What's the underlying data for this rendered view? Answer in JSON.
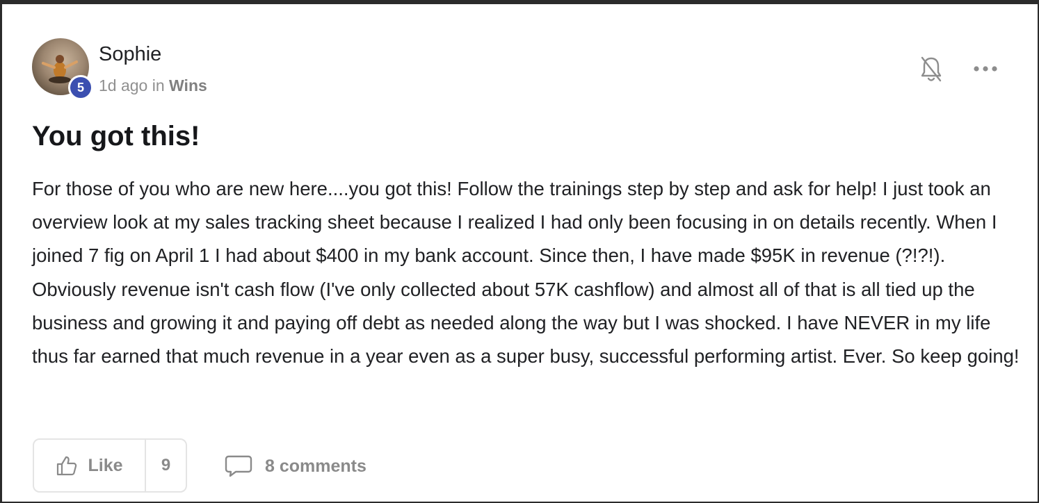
{
  "post": {
    "author": {
      "name": "Sophie",
      "level": "5"
    },
    "meta": {
      "time_ago": "1d ago",
      "in_word": "in",
      "category": "Wins"
    },
    "title": "You got this!",
    "body": "For those of you who are new here....you got this! Follow the trainings step by step and ask for help! I just took an overview look at my sales tracking sheet because I realized I had only been focusing in on details recently. When I joined 7 fig on April 1 I had about $400 in my bank account. Since then, I have made $95K in revenue (?!?!). Obviously revenue isn't cash flow (I've only collected about 57K cashflow) and almost all of that is all tied up the business and growing it and paying off debt as needed along the way but I was shocked. I have NEVER in my life thus far earned that much revenue in a year even as a super busy, successful performing artist. Ever. So keep going!",
    "actions": {
      "like_label": "Like",
      "like_count": "9",
      "comments_label": "8 comments"
    },
    "icons": {
      "bell": "bell-off-icon",
      "more": "more-horizontal-icon",
      "like": "thumbs-up-icon",
      "comment": "comment-bubble-icon"
    },
    "colors": {
      "level_badge": "#3b4fb0",
      "muted_text": "#8a8a8a"
    }
  }
}
